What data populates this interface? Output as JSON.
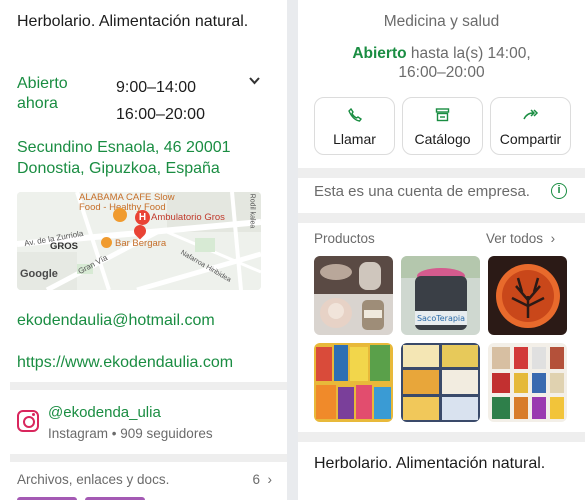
{
  "left": {
    "title": "Herbolario. Alimentación natural.",
    "hours": {
      "status": "Abierto ahora",
      "slot1": "9:00–14:00",
      "slot2": "16:00–20:00"
    },
    "address": "Secundino Esnaola, 46 20001 Donostia, Gipuzkoa, España",
    "map": {
      "labels": {
        "top": "ALABAMA CAFE Slow",
        "fhf": "Food - Healthy Food",
        "ambulatorio": "Ambulatorio Gros",
        "zurriola": "Av. de la Zurriola",
        "gros": "GROS",
        "bar": "Bar Bergara",
        "granvia": "Gran Vía",
        "rodil": "Rodil kalea",
        "nafarroa": "Nafarroa Hiribidea",
        "google": "Google"
      }
    },
    "email": "ekodendaulia@hotmail.com",
    "website": "https://www.ekodendaulia.com",
    "instagram": {
      "handle": "@ekodenda_ulia",
      "subtitle": "Instagram • 909 seguidores"
    },
    "files": {
      "label": "Archivos, enlaces y docs.",
      "count": "6",
      "chevron": "›"
    }
  },
  "right": {
    "category": "Medicina y salud",
    "hours": {
      "status": "Abierto",
      "text": " hasta la(s) 14:00,",
      "text2": "16:00–20:00"
    },
    "actions": [
      {
        "label": "Llamar",
        "icon": "phone-icon"
      },
      {
        "label": "Catálogo",
        "icon": "store-icon"
      },
      {
        "label": "Compartir",
        "icon": "forward-icon"
      }
    ],
    "business_note": "Esta es una cuenta de empresa.",
    "info_glyph": "i",
    "products": {
      "heading": "Productos",
      "see_all": "Ver todos",
      "chevron": "›"
    },
    "footer_title": "Herbolario. Alimentación natural."
  },
  "colors": {
    "green": "#1a8d42",
    "instagram": "#d9265d",
    "pin": "#e94335"
  }
}
